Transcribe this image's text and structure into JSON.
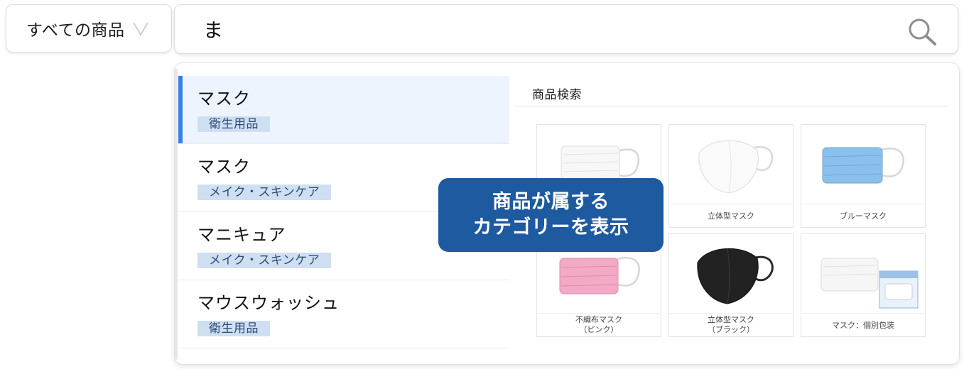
{
  "category_select": {
    "label": "すべての商品",
    "icon": "chevron-down-icon"
  },
  "search": {
    "value": "ま",
    "icon": "search-icon"
  },
  "suggestions": [
    {
      "term": "マスク",
      "category": "衛生用品",
      "active": true
    },
    {
      "term": "マスク",
      "category": "メイク・スキンケア",
      "active": false
    },
    {
      "term": "マニキュア",
      "category": "メイク・スキンケア",
      "active": false
    },
    {
      "term": "マウスウォッシュ",
      "category": "衛生用品",
      "active": false
    }
  ],
  "results": {
    "title": "商品検索",
    "products": [
      {
        "caption": "",
        "caption2": "",
        "image": "white-pleated-mask",
        "color": "#ffffff"
      },
      {
        "caption": "立体型マスク",
        "caption2": "",
        "image": "white-3d-mask",
        "color": "#ffffff"
      },
      {
        "caption": "ブルーマスク",
        "caption2": "",
        "image": "blue-pleated-mask",
        "color": "#7fb6e6"
      },
      {
        "caption": "不織布マスク",
        "caption2": "（ピンク）",
        "image": "pink-pleated-mask",
        "color": "#f1a9c4"
      },
      {
        "caption": "立体型マスク",
        "caption2": "（ブラック）",
        "image": "black-3d-mask",
        "color": "#222222"
      },
      {
        "caption": "マスク：個別包装",
        "caption2": "",
        "image": "individually-wrapped-mask",
        "color": "#ffffff"
      }
    ]
  },
  "callout": {
    "line1": "商品が属する",
    "line2": "カテゴリーを表示"
  },
  "colors": {
    "accent": "#3b7fe6",
    "tag_bg": "#cfdff2",
    "callout_bg": "#1e5aa0"
  }
}
